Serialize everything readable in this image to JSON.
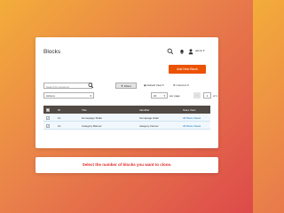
{
  "header": {
    "title": "Blocks",
    "admin_label": "admin ▾"
  },
  "toolbar": {
    "add_new_label": "Add New Block",
    "search_placeholder": "Search by keyword",
    "filters_label": "▼ Filters",
    "default_view_label": "Default View ▾",
    "columns_label": "Columns ▾",
    "actions_label": "Actions",
    "per_page_value": "20",
    "per_page_label": "per page",
    "page_prev": "‹",
    "page_current": "1",
    "page_of": "of 1"
  },
  "table": {
    "columns": [
      "ID",
      "Title",
      "Identifier",
      "Store View"
    ],
    "rows": [
      {
        "id": "11",
        "title": "Homepage Slider",
        "identifier": "homepage slider",
        "store_view": "All Store Views"
      },
      {
        "id": "12",
        "title": "Category Banner",
        "identifier": "category banner",
        "store_view": "All Store Views"
      }
    ]
  },
  "banner": {
    "text": "Select the number of blocks you want to clone."
  },
  "colors": {
    "accent": "#eb5202",
    "table_header": "#514943",
    "banner_text": "#e02b27"
  }
}
